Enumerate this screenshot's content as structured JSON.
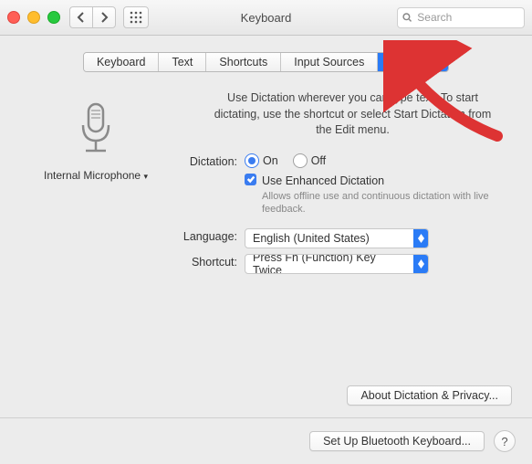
{
  "window": {
    "title": "Keyboard"
  },
  "search": {
    "placeholder": "Search"
  },
  "tabs": {
    "items": [
      "Keyboard",
      "Text",
      "Shortcuts",
      "Input Sources",
      "Dictation"
    ],
    "active_index": 4
  },
  "microphone": {
    "label": "Internal Microphone"
  },
  "intro": "Use Dictation wherever you can type text. To start dictating, use the shortcut or select Start Dictation from the Edit menu.",
  "dictation": {
    "label": "Dictation:",
    "on_label": "On",
    "off_label": "Off",
    "selected": "on",
    "enhanced": {
      "checked": true,
      "label": "Use Enhanced Dictation",
      "description": "Allows offline use and continuous dictation with live feedback."
    }
  },
  "language": {
    "label": "Language:",
    "value": "English (United States)"
  },
  "shortcut": {
    "label": "Shortcut:",
    "value": "Press Fn (Function) Key Twice"
  },
  "buttons": {
    "about": "About Dictation & Privacy...",
    "bluetooth": "Set Up Bluetooth Keyboard...",
    "help": "?"
  }
}
